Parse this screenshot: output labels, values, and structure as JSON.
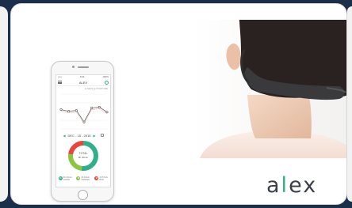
{
  "app": {
    "status_carrier": "•••••",
    "status_time": "9:41",
    "status_battery": "100%",
    "title": "ALEX",
    "legend": "● NECK ● POSTURE",
    "date": "DEC - 15 - 2015",
    "prev_arrow": "◀",
    "next_arrow": "▶",
    "total_label": "TOTAL",
    "total_value": "8h 30min",
    "stats": [
      {
        "badge": "G",
        "color": "#2fb08a",
        "line1": "4h 23min",
        "line2": "GOOD"
      },
      {
        "badge": "N",
        "color": "#8cc63f",
        "line1": "2h 10min",
        "line2": "NORMAL"
      },
      {
        "badge": "B",
        "color": "#e8453c",
        "line1": "1h 57min",
        "line2": "BAD"
      }
    ]
  },
  "graph": {
    "y": [
      70,
      66,
      68,
      40,
      74,
      76,
      64
    ],
    "series_color": "#555555",
    "alt_color": "#f2b8b8"
  },
  "donut": {
    "segments": [
      {
        "name": "good",
        "value": 52,
        "color": "#2fb08a"
      },
      {
        "name": "normal",
        "value": 25,
        "color": "#8cc63f"
      },
      {
        "name": "bad",
        "value": 23,
        "color": "#e8453c"
      }
    ]
  },
  "brand": {
    "logo_prefix": "a",
    "logo_mid": "l",
    "logo_suffix": "ex",
    "accent": "#2fb08a"
  }
}
